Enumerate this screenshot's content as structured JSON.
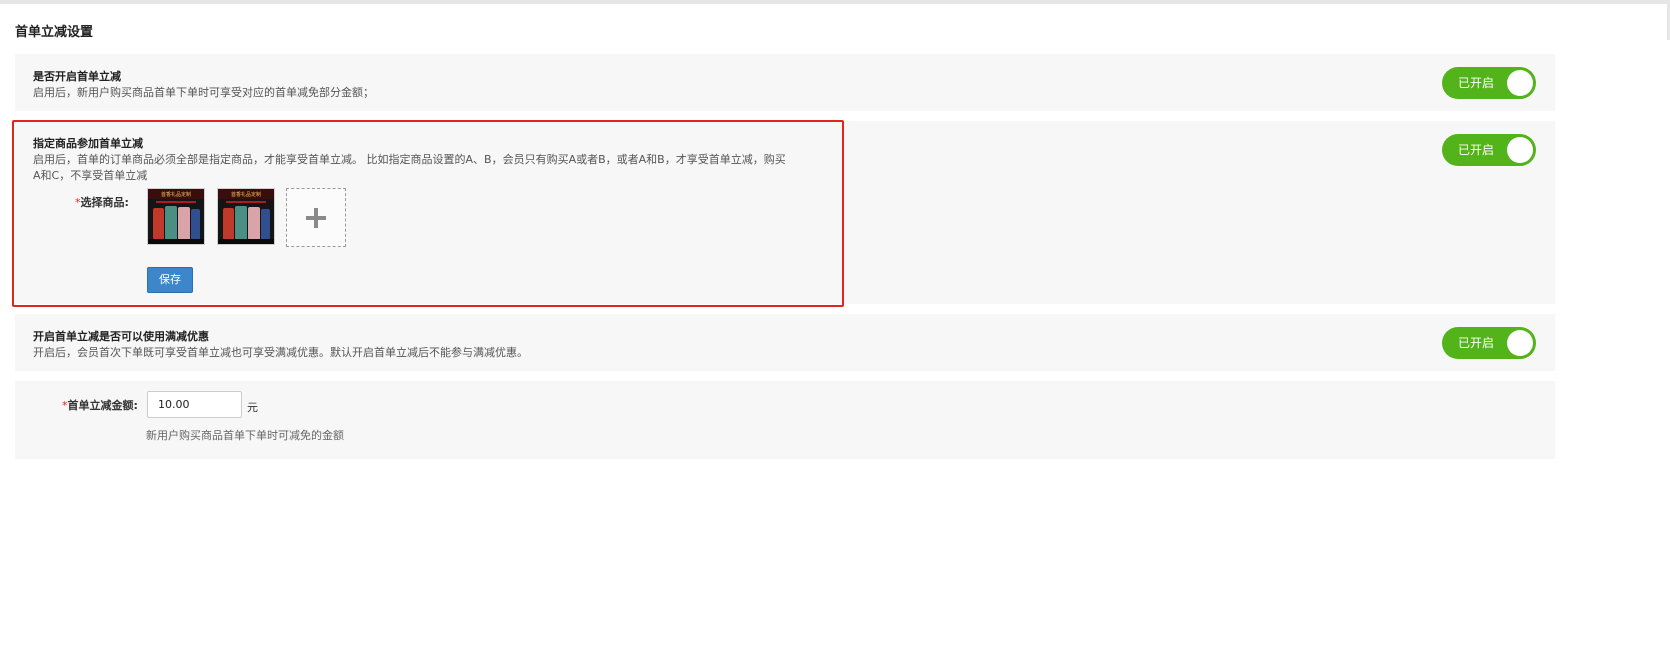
{
  "page": {
    "title": "首单立减设置"
  },
  "sections": {
    "enable": {
      "title": "是否开启首单立减",
      "desc": "启用后，新用户购买商品首单下单时可享受对应的首单减免部分金额；",
      "toggle_label": "已开启"
    },
    "designated": {
      "title": "指定商品参加首单立减",
      "desc": "启用后，首单的订单商品必须全部是指定商品，才能享受首单立减。 比如指定商品设置的A、B，会员只有购买A或者B，或者A和B，才享受首单立减，购买A和C，不享受首单立减",
      "toggle_label": "已开启",
      "field_required_mark": "*",
      "field_label": "选择商品:",
      "products": [
        {
          "banner_text": "首香礼品定制"
        },
        {
          "banner_text": "首香礼品定制"
        }
      ],
      "save_label": "保存"
    },
    "full_reduction": {
      "title": "开启首单立减是否可以使用满减优惠",
      "desc": "开启后，会员首次下单既可享受首单立减也可享受满减优惠。默认开启首单立减后不能参与满减优惠。",
      "toggle_label": "已开启"
    },
    "amount": {
      "required_mark": "*",
      "label": "首单立减金额:",
      "value": "10.00",
      "unit": "元",
      "hint": "新用户购买商品首单下单时可减免的金额"
    }
  },
  "colors": {
    "toggle_on": "#52b31a",
    "primary_button": "#3c86c9",
    "highlight_border": "#e0251b",
    "panel_bg": "#f7f7f7"
  }
}
